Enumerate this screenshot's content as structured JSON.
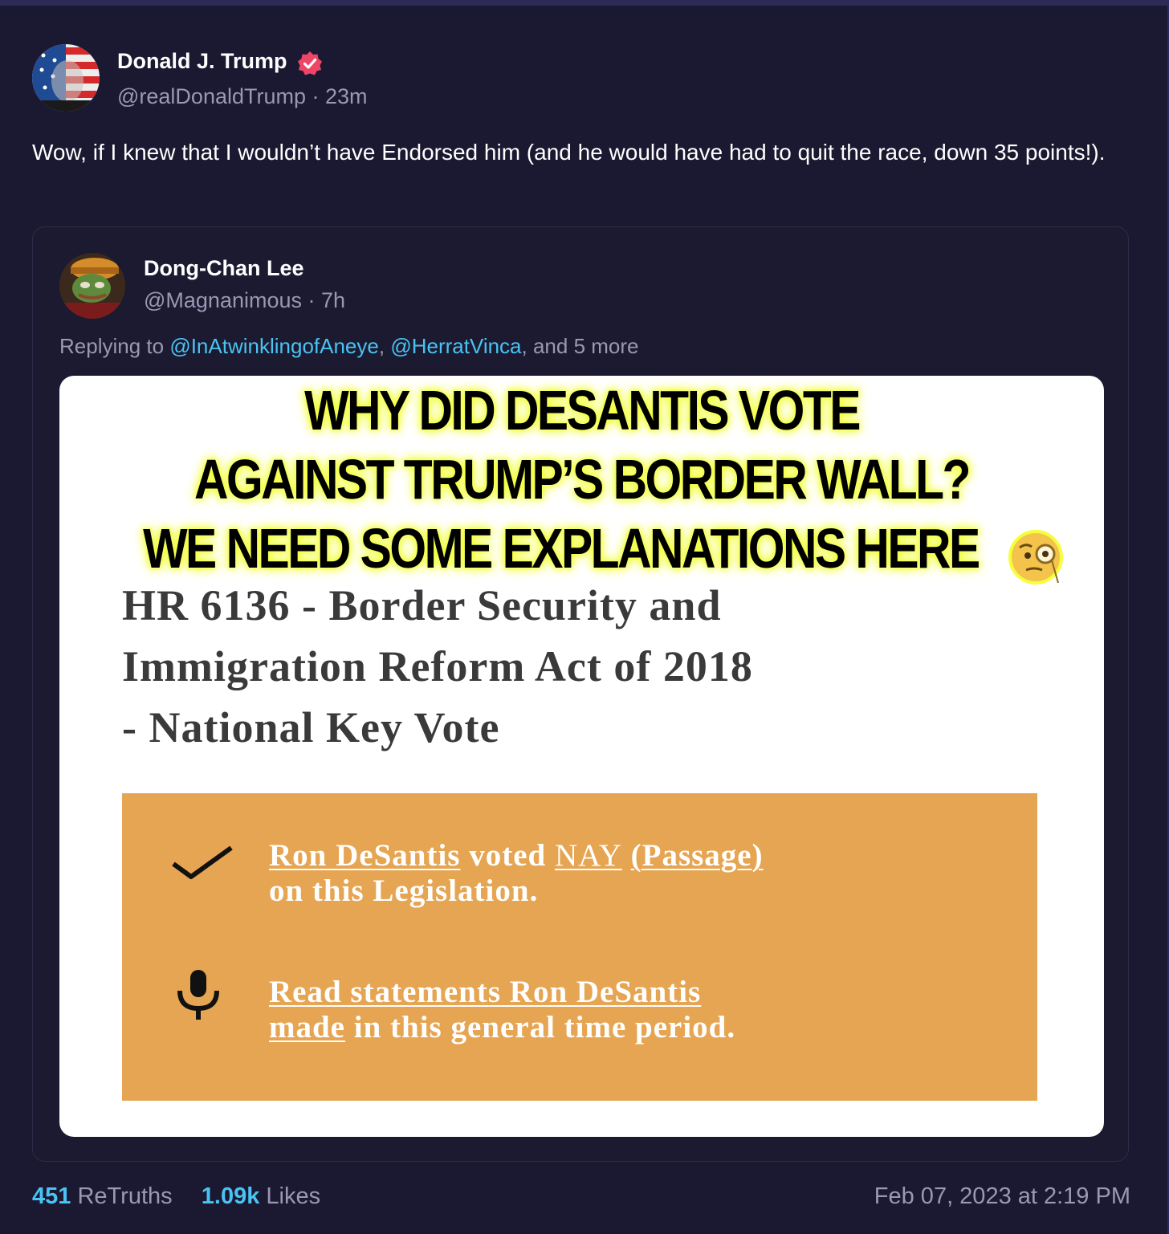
{
  "post": {
    "author_name": "Donald J. Trump",
    "handle_time": "@realDonaldTrump · 23m",
    "text": "Wow, if I knew that I wouldn’t have Endorsed him (and he would have had to quit the race, down 35 points!).",
    "verified_icon": "verified-badge-icon",
    "verified_color": "#ee4566"
  },
  "quote": {
    "author_name": "Dong-Chan Lee",
    "handle_time": "@Magnanimous · 7h",
    "reply_prefix": "Replying to ",
    "mention_1": "@InAtwinklingofAneye",
    "separator": ", ",
    "mention_2": "@HerratVinca",
    "reply_suffix": ", and 5 more",
    "image": {
      "headline_1": "WHY DID DESANTIS VOTE",
      "headline_2": "AGAINST TRUMP’S BORDER WALL?",
      "headline_3": "WE NEED SOME EXPLANATIONS HERE",
      "bill_1": "HR 6136 - Border Security and",
      "bill_2": "Immigration Reform Act of 2018",
      "bill_3": "- National Key Vote",
      "vote_name": "Ron DeSantis",
      "vote_mid": " voted ",
      "vote_nay": "NAY",
      "vote_passage": "(Passage)",
      "vote_line2": "on this Legislation.",
      "statements_line1": "Read statements Ron DeSantis",
      "statements_made": "made",
      "statements_rest": " in this general time period.",
      "box_color": "#e6a552"
    }
  },
  "stats": {
    "retruths_count": "451",
    "retruths_label": " ReTruths",
    "likes_count": "1.09k",
    "likes_label": " Likes",
    "timestamp": "Feb 07, 2023 at 2:19 PM"
  },
  "colors": {
    "background": "#1b1831",
    "mention": "#49c3f2",
    "muted": "#9b97b4"
  }
}
